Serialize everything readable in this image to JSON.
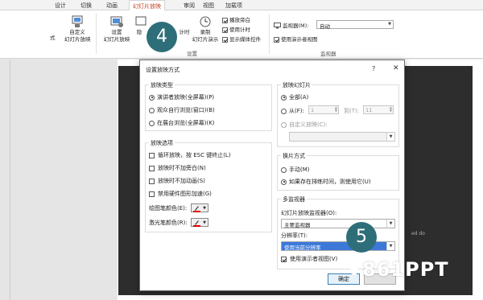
{
  "ribbon": {
    "tabs": [
      "设计",
      "切换",
      "动画",
      "幻灯片放映",
      "审阅",
      "视图",
      "加载项"
    ],
    "active_tab": "幻灯片放映",
    "partial_left": "式",
    "custom_show": "自定义\n幻灯片放映",
    "setup_show": "设置\n幻灯片放映",
    "hide_slide": "隐",
    "timing": "计时",
    "record": "录制\n幻灯片演示",
    "chk_narration": "播放旁白",
    "chk_timings": "使用计时",
    "chk_media": "显示媒体控件",
    "group_setup": "设置",
    "monitor_label": "监视器(M):",
    "monitor_value": "自动",
    "presenter_view": "使用演示者视图",
    "group_monitor": "监视器"
  },
  "dialog": {
    "title": "设置放映方式",
    "help": "?",
    "close": "✕",
    "show_type": {
      "legend": "放映类型",
      "options": [
        "演讲者放映(全屏幕)(P)",
        "观众自行浏览(窗口)(B)",
        "在展台浏览(全屏幕)(K)"
      ]
    },
    "show_options": {
      "legend": "放映选项",
      "options": [
        "循环放映，按 ESC 键终止(L)",
        "放映时不加旁白(N)",
        "放映时不加动画(S)",
        "禁用硬件图形加速(G)"
      ],
      "pen_color": "绘图笔颜色(E):",
      "laser_color": "激光笔颜色(R):"
    },
    "slides": {
      "legend": "放映幻灯片",
      "all": "全部(A)",
      "from": "从(F):",
      "from_value": "1",
      "to": "到(T):",
      "to_value": "11",
      "custom": "自定义放映(C):"
    },
    "advance": {
      "legend": "换片方式",
      "manual": "手动(M)",
      "timings": "如果存在排练时间，则使用它(U)"
    },
    "monitors": {
      "legend": "多监视器",
      "monitor_label": "幻灯片放映监视器(O):",
      "monitor_value": "主要监视器",
      "resolution_label": "分辨率(T):",
      "resolution_value": "使用当前分辨率",
      "presenter_view": "使用演示者视图(V)"
    },
    "ok": "确定"
  },
  "callouts": [
    "4",
    "5"
  ],
  "slide_text": "ed do",
  "watermark": "861PPT",
  "colors": {
    "accent": "#c43e1c",
    "badge": "#2e6e79",
    "pen": "#e00000",
    "highlight": "#3b78d8"
  }
}
